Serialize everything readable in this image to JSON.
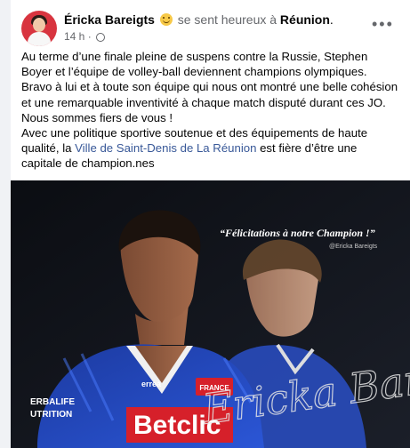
{
  "post": {
    "author": "Éricka Bareigts",
    "feeling_text": "se sent heureux à",
    "location": "Réunion",
    "location_suffix": ".",
    "time": "14 h",
    "dot": "·",
    "more_icon": "more-options-icon",
    "paragraphs": [
      "Au terme d’une finale pleine de suspens contre la Russie, Stephen Boyer et l’équipe de volley-ball deviennent champions olympiques. Bravo à lui et à toute son équipe qui nous ont montré une belle cohésion et une remarquable inventivité à chaque match disputé durant ces JO. Nous sommes fiers de vous !",
      "Avec une politique sportive soutenue et des équipements de haute qualité, la"
    ],
    "link_text": "Ville de Saint-Denis de La Réunion",
    "after_link": "est fière d’être une capitale de champion.nes"
  },
  "image": {
    "quote": "“Félicitations à notre Champion !”",
    "credit": "@Ericka Bareigts",
    "signature": "Ericka Bareigts",
    "jersey_sponsor": "Betclic",
    "jersey_side_top": "ERBALIFE",
    "jersey_side_bottom": "UTRITION",
    "jersey_brand": "erreà",
    "jersey_badge": "FRANCE"
  },
  "colors": {
    "link": "#385898",
    "muted": "#65676b",
    "jersey_blue": "#1f3fa8",
    "sponsor_red": "#d6202a"
  }
}
